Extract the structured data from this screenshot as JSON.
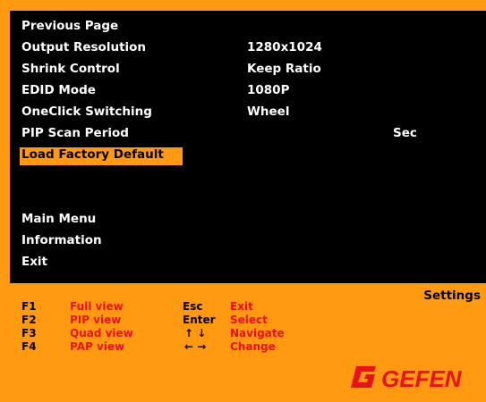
{
  "menu": {
    "items": [
      {
        "label": "Previous Page",
        "value": ""
      },
      {
        "label": "Output Resolution",
        "value": "1280x1024"
      },
      {
        "label": "Shrink Control",
        "value": "Keep Ratio"
      },
      {
        "label": "EDID Mode",
        "value": "1080P"
      },
      {
        "label": "OneClick Switching",
        "value": "Wheel"
      },
      {
        "label": "PIP Scan Period",
        "value": "",
        "unit": "Sec"
      },
      {
        "label": "Load Factory Default",
        "value": "",
        "selected": true
      }
    ],
    "bottom_items": [
      {
        "label": "Main Menu"
      },
      {
        "label": "Information"
      },
      {
        "label": "Exit"
      }
    ],
    "highlight_color": "#ff9a10"
  },
  "footer": {
    "title": "Settings",
    "fkeys": [
      {
        "key": "F1",
        "action": "Full view"
      },
      {
        "key": "F2",
        "action": "PIP view"
      },
      {
        "key": "F3",
        "action": "Quad view"
      },
      {
        "key": "F4",
        "action": "PAP view"
      }
    ],
    "nav_keys": [
      {
        "key": "Esc",
        "action": "Exit"
      },
      {
        "key": "Enter",
        "action": "Select"
      },
      {
        "key": "↑ ↓",
        "action": "Navigate"
      },
      {
        "key": "← →",
        "action": "Change"
      }
    ],
    "action_color": "#e8121d"
  },
  "brand": {
    "logo_text": "GEFEN",
    "logo_color": "#e8121d"
  }
}
